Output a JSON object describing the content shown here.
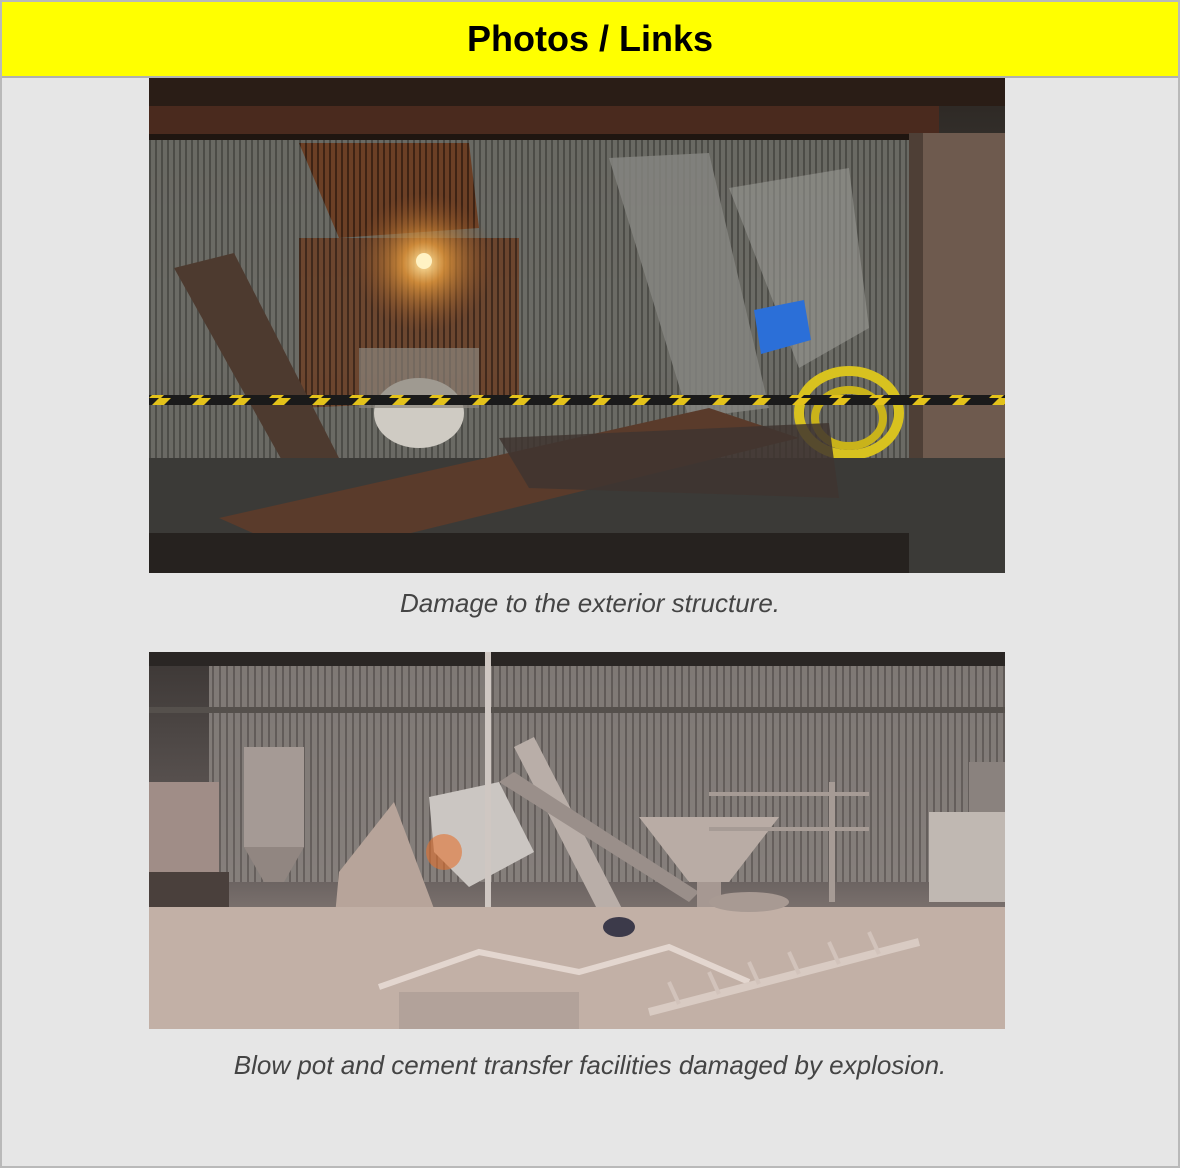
{
  "section": {
    "title": "Photos / Links"
  },
  "photos": [
    {
      "caption": "Damage to the exterior structure."
    },
    {
      "caption": "Blow pot and cement transfer facilities damaged by explosion."
    }
  ],
  "colors": {
    "header_bg": "#ffff00",
    "panel_bg": "#e6e6e6",
    "caption_text": "#444444"
  }
}
